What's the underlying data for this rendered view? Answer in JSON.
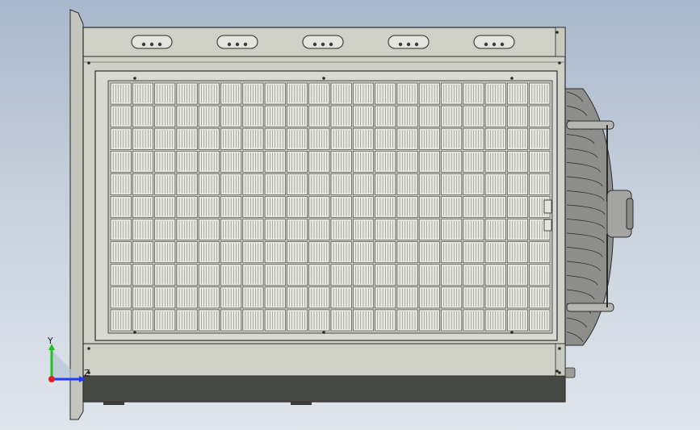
{
  "viewport": {
    "background_top": "#a9b8cc",
    "background_bottom": "#e0e5ec"
  },
  "model": {
    "body_color": "#cfd0c6",
    "edge_color": "#2a2a2a",
    "base_color": "#464844",
    "grille_color": "#e8e9e2",
    "grille_rows": 11,
    "grille_cols": 20,
    "top_slot_count": 5,
    "fan_color": "#9a9b98"
  },
  "triad": {
    "y_label": "Y",
    "z_label": "Z",
    "y_color": "#22c022",
    "z_color": "#1e3cff",
    "x_color": "#e02020"
  }
}
